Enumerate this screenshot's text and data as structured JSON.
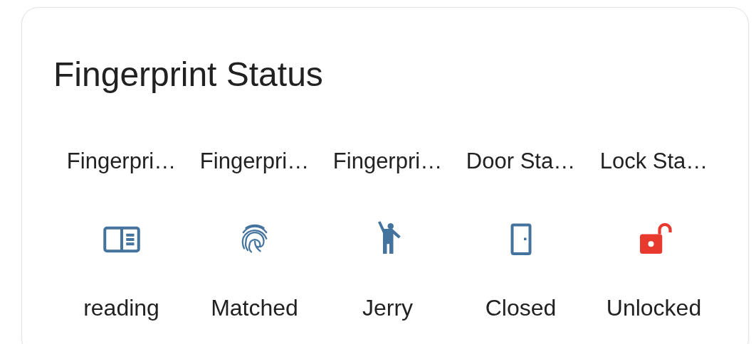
{
  "card": {
    "title": "Fingerprint Status",
    "entities": [
      {
        "name": "Fingerpri…",
        "kind": "panel",
        "color": "#44739e",
        "state": "reading"
      },
      {
        "name": "Fingerpri…",
        "kind": "fingerprint",
        "color": "#44739e",
        "state": "Matched"
      },
      {
        "name": "Fingerpri…",
        "kind": "person",
        "color": "#44739e",
        "state": "Jerry"
      },
      {
        "name": "Door Sta…",
        "kind": "door",
        "color": "#44739e",
        "state": "Closed"
      },
      {
        "name": "Lock Sta…",
        "kind": "lock",
        "color": "#e8392f",
        "state": "Unlocked"
      }
    ]
  }
}
